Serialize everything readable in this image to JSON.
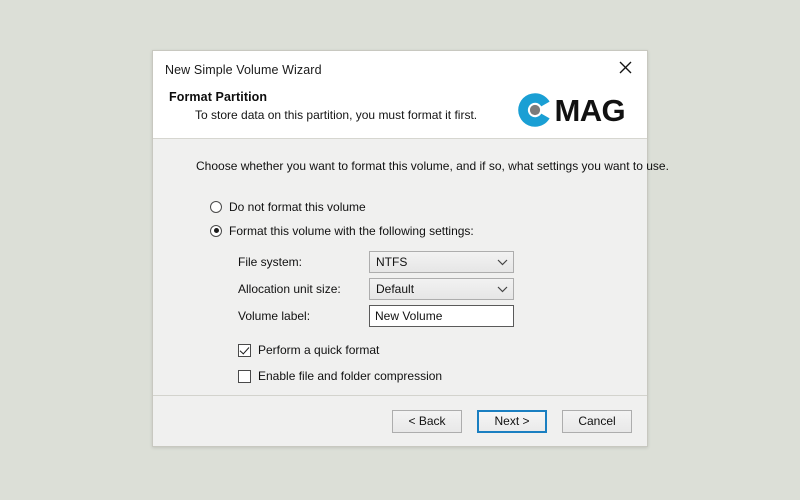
{
  "window": {
    "title": "New Simple Volume Wizard",
    "close_icon": "close-x-icon"
  },
  "header": {
    "title": "Format Partition",
    "subtitle": "To store data on this partition, you must format it first.",
    "brand": {
      "word": "MAG",
      "mark_icon": "cmag-c-ring-logo",
      "accent_color": "#1a9fd4",
      "dot_color": "#7b7b7b"
    }
  },
  "body": {
    "intro": "Choose whether you want to format this volume, and if so, what settings you want to use.",
    "radio_group": {
      "name": "format-choice",
      "options": [
        {
          "label": "Do not format this volume",
          "selected": false
        },
        {
          "label": "Format this volume with the following settings:",
          "selected": true
        }
      ]
    },
    "fields": [
      {
        "label": "File system:",
        "control": "combobox",
        "value": "NTFS",
        "arrow_icon": "chevron-down-icon"
      },
      {
        "label": "Allocation unit size:",
        "control": "combobox",
        "value": "Default",
        "arrow_icon": "chevron-down-icon"
      },
      {
        "label": "Volume label:",
        "control": "textbox",
        "value": "New Volume"
      }
    ],
    "checkboxes": [
      {
        "label": "Perform a quick format",
        "checked": true
      },
      {
        "label": "Enable file and folder compression",
        "checked": false
      }
    ]
  },
  "footer": {
    "buttons": [
      {
        "label": "< Back",
        "primary": false
      },
      {
        "label": "Next >",
        "primary": true
      },
      {
        "label": "Cancel",
        "primary": false
      }
    ]
  }
}
